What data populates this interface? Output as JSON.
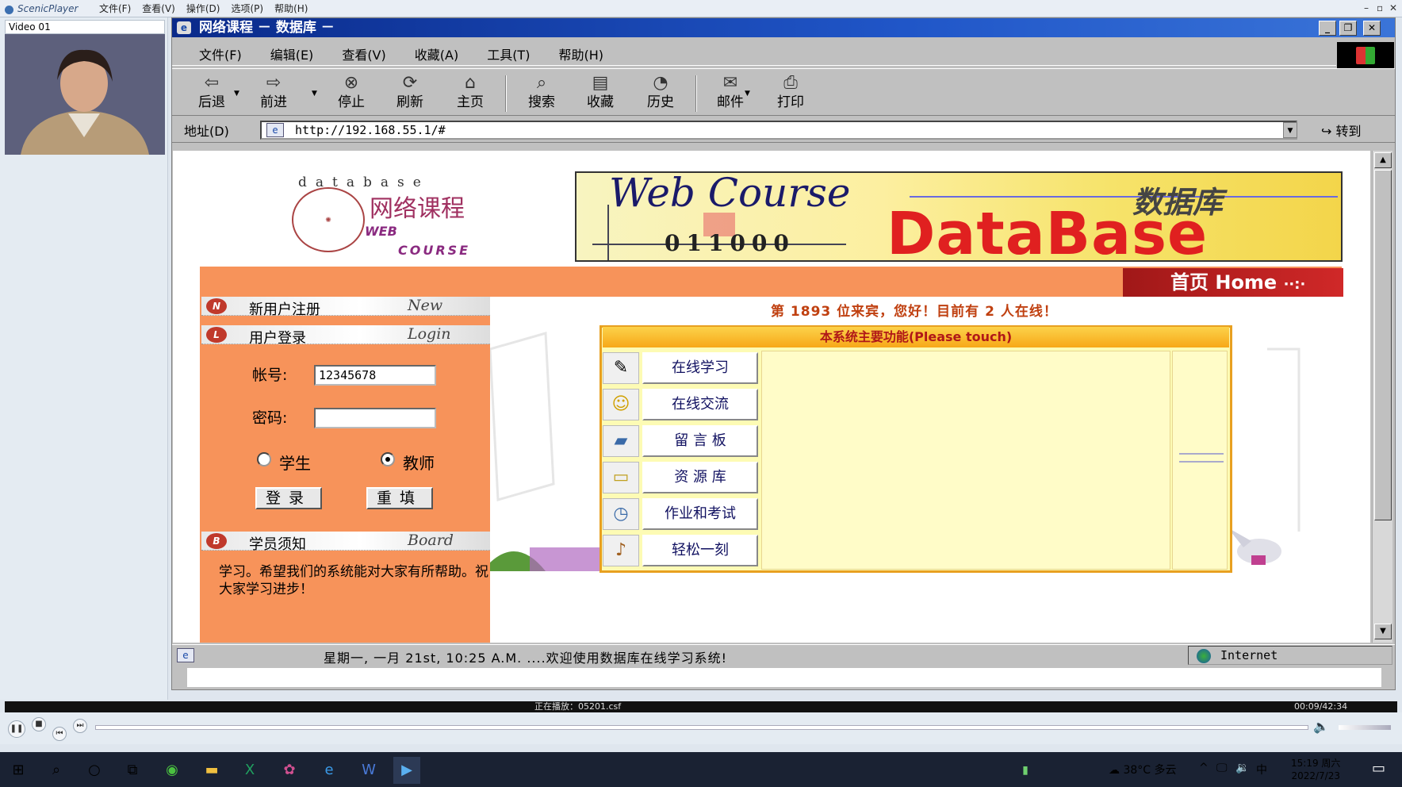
{
  "player": {
    "logo": "ScenicPlayer",
    "menu": [
      "文件(F)",
      "查看(V)",
      "操作(D)",
      "选项(P)",
      "帮助(H)"
    ],
    "video_label": "Video 01",
    "now_playing": "正在播放：05201.csf",
    "elapsed": "00:09/42:34"
  },
  "browser": {
    "title": "网络课程 － 数据库 －",
    "menu": [
      "文件(F)",
      "编辑(E)",
      "查看(V)",
      "收藏(A)",
      "工具(T)",
      "帮助(H)"
    ],
    "toolbar": [
      "后退",
      "前进",
      "停止",
      "刷新",
      "主页",
      "搜索",
      "收藏",
      "历史",
      "邮件",
      "打印"
    ],
    "address_label": "地址(D)",
    "url": "http://192.168.55.1/#",
    "go_label": "转到",
    "status_text": "星期一, 一月 21st,  10:25 A.M.  ....欢迎使用数据库在线学习系统!",
    "zone": "Internet"
  },
  "site": {
    "logo_word": "database",
    "logo_cn": "网络课程",
    "logo_web": "WEB",
    "logo_course": "COURSE",
    "banner_title": "Web Course",
    "banner_cn": "数据库",
    "banner_db": "DataBase",
    "banner_num": "011000",
    "home_label": "首页 Home",
    "welcome": "第 1893 位来宾，您好！目前有 2 人在线！",
    "left_sections": [
      {
        "badge": "N",
        "cn": "新用户注册",
        "en": "New"
      },
      {
        "badge": "L",
        "cn": "用户登录",
        "en": "Login"
      },
      {
        "badge": "B",
        "cn": "学员须知",
        "en": "Board"
      }
    ],
    "login": {
      "user_label": "帐号:",
      "user_value": "12345678",
      "pass_label": "密码:",
      "role_student": "学生",
      "role_teacher": "教师",
      "selected_role": "教师",
      "login_btn": "登录",
      "reset_btn": "重填"
    },
    "notice": "学习。希望我们的系统能对大家有所帮助。祝大家学习进步！",
    "functions_header": "本系统主要功能(Please touch)",
    "functions": [
      {
        "label": "在线学习",
        "icon": "book-icon"
      },
      {
        "label": "在线交流",
        "icon": "smiley-icon"
      },
      {
        "label": "留 言 板",
        "icon": "notebook-icon"
      },
      {
        "label": "资 源 库",
        "icon": "folder-icon"
      },
      {
        "label": "作业和考试",
        "icon": "clock-icon"
      },
      {
        "label": "轻松一刻",
        "icon": "music-note-icon"
      }
    ]
  },
  "taskbar": {
    "weather": "38°C 多云",
    "ime": "中",
    "time": "15:19 周六",
    "date": "2022/7/23"
  }
}
